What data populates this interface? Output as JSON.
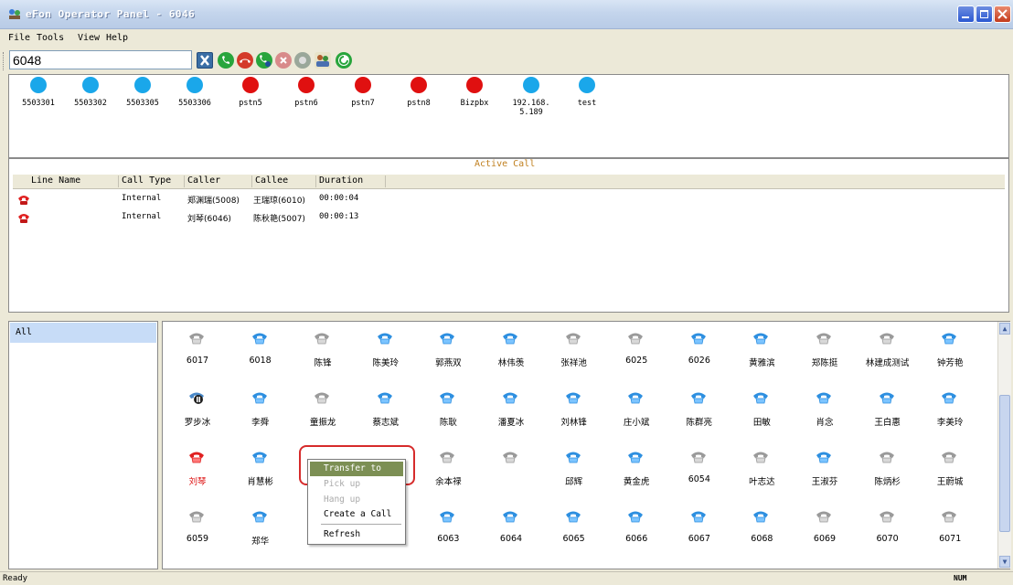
{
  "window": {
    "title": "eFon Operator Panel - 6046"
  },
  "menu": [
    "File",
    "Tools",
    "View",
    "Help"
  ],
  "toolbar": {
    "dial_value": "6048"
  },
  "trunks": [
    {
      "label": "5503301",
      "status": "blue"
    },
    {
      "label": "5503302",
      "status": "blue"
    },
    {
      "label": "5503305",
      "status": "blue"
    },
    {
      "label": "5503306",
      "status": "blue"
    },
    {
      "label": "pstn5",
      "status": "red"
    },
    {
      "label": "pstn6",
      "status": "red"
    },
    {
      "label": "pstn7",
      "status": "red"
    },
    {
      "label": "pstn8",
      "status": "red"
    },
    {
      "label": "Bizpbx",
      "status": "red"
    },
    {
      "label": "192.168.5.189",
      "status": "blue"
    },
    {
      "label": "test",
      "status": "blue"
    }
  ],
  "active_call": {
    "legend": "Active Call",
    "columns": [
      "Line Name",
      "Call Type",
      "Caller",
      "Callee",
      "Duration"
    ],
    "rows": [
      {
        "line": "",
        "type": "Internal",
        "caller": "郑渊瑞(5008)",
        "callee": "王瑞琼(6010)",
        "duration": "00:00:04"
      },
      {
        "line": "",
        "type": "Internal",
        "caller": "刘琴(6046)",
        "callee": "陈秋艳(5007)",
        "duration": "00:00:13"
      }
    ]
  },
  "groups": [
    {
      "label": "All"
    }
  ],
  "extensions": [
    [
      {
        "n": "6017",
        "s": "gray"
      },
      {
        "n": "6018",
        "s": "blue"
      },
      {
        "n": "陈锋",
        "s": "gray"
      },
      {
        "n": "陈美玲",
        "s": "blue"
      },
      {
        "n": "郭燕双",
        "s": "blue"
      },
      {
        "n": "林伟羡",
        "s": "blue"
      },
      {
        "n": "张祥池",
        "s": "gray"
      },
      {
        "n": "6025",
        "s": "gray"
      },
      {
        "n": "6026",
        "s": "blue"
      },
      {
        "n": "黄雅滨",
        "s": "blue"
      },
      {
        "n": "郑陈挺",
        "s": "gray"
      },
      {
        "n": "林建成测试",
        "s": "gray"
      },
      {
        "n": "钟芳艳",
        "s": "blue"
      }
    ],
    [
      {
        "n": "罗步冰",
        "s": "hold"
      },
      {
        "n": "李舜",
        "s": "blue"
      },
      {
        "n": "童振龙",
        "s": "gray"
      },
      {
        "n": "蔡志斌",
        "s": "blue"
      },
      {
        "n": "陈耿",
        "s": "blue"
      },
      {
        "n": "潘夏冰",
        "s": "blue"
      },
      {
        "n": "刘林锋",
        "s": "blue"
      },
      {
        "n": "庄小斌",
        "s": "blue"
      },
      {
        "n": "陈群亮",
        "s": "blue"
      },
      {
        "n": "田敏",
        "s": "blue"
      },
      {
        "n": "肖念",
        "s": "blue"
      },
      {
        "n": "王白惠",
        "s": "blue"
      },
      {
        "n": "李美玲",
        "s": "blue"
      }
    ],
    [
      {
        "n": "刘琴",
        "s": "red"
      },
      {
        "n": "肖慧彬",
        "s": "blue"
      },
      {
        "n": "",
        "s": "hidden"
      },
      {
        "n": "",
        "s": "hidden"
      },
      {
        "n": "余本禄",
        "s": "gray"
      },
      {
        "n": "",
        "s": "gray"
      },
      {
        "n": "邱辉",
        "s": "blue"
      },
      {
        "n": "黄金虎",
        "s": "blue"
      },
      {
        "n": "6054",
        "s": "gray"
      },
      {
        "n": "叶志达",
        "s": "gray"
      },
      {
        "n": "王淑芬",
        "s": "blue"
      },
      {
        "n": "陈炳杉",
        "s": "gray"
      },
      {
        "n": "王蔚城",
        "s": "gray"
      }
    ],
    [
      {
        "n": "6059",
        "s": "gray"
      },
      {
        "n": "郑华",
        "s": "blue"
      },
      {
        "n": "",
        "s": "hidden"
      },
      {
        "n": "",
        "s": "hidden"
      },
      {
        "n": "6063",
        "s": "blue"
      },
      {
        "n": "6064",
        "s": "blue"
      },
      {
        "n": "6065",
        "s": "blue"
      },
      {
        "n": "6066",
        "s": "blue"
      },
      {
        "n": "6067",
        "s": "blue"
      },
      {
        "n": "6068",
        "s": "blue"
      },
      {
        "n": "6069",
        "s": "gray"
      },
      {
        "n": "6070",
        "s": "gray"
      },
      {
        "n": "6071",
        "s": "gray"
      }
    ]
  ],
  "context_menu": {
    "items": [
      {
        "label": "Transfer to",
        "state": "selected"
      },
      {
        "label": "Pick up",
        "state": "disabled"
      },
      {
        "label": "Hang up",
        "state": "disabled"
      },
      {
        "label": "Create a Call",
        "state": "enabled"
      },
      {
        "label": "Refresh",
        "state": "enabled"
      }
    ]
  },
  "status": {
    "text": "Ready",
    "num": "NUM"
  },
  "colors": {
    "blue_dot": "#1aa7ea",
    "red_dot": "#e01010",
    "selected_menu": "#7c8f54",
    "group_selected": "#c7dcf7"
  }
}
